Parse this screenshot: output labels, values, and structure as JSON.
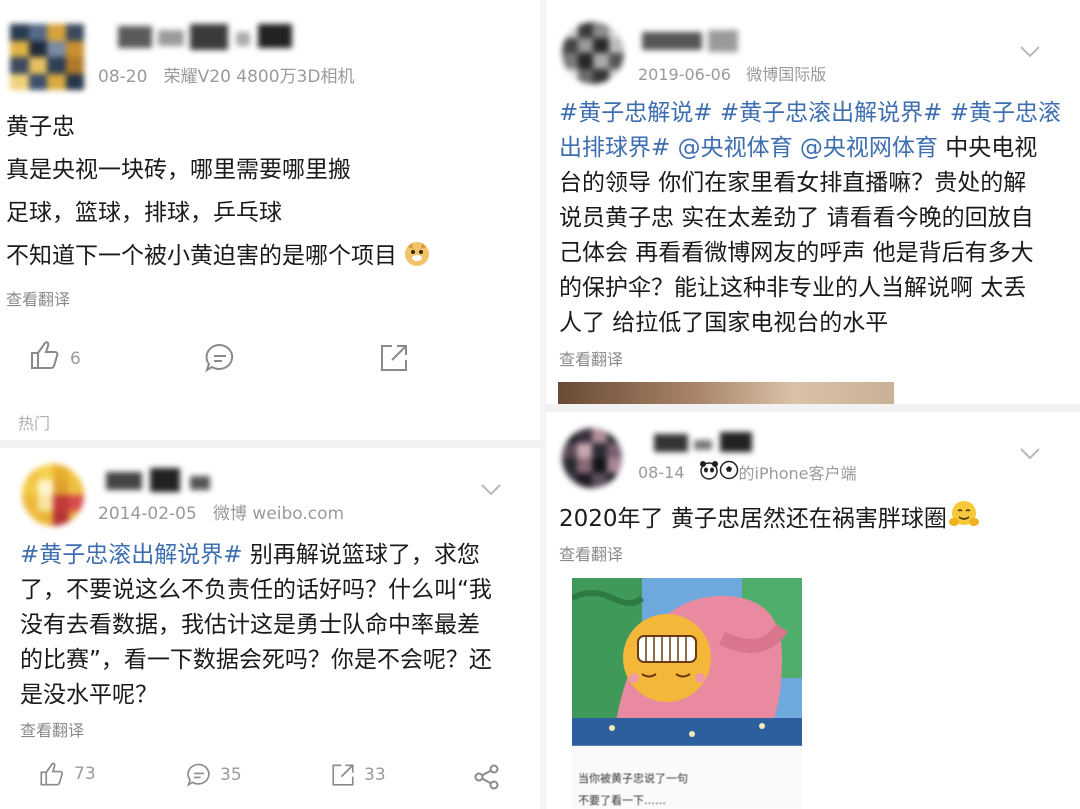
{
  "left_top": {
    "date": "08-20",
    "device": "荣耀V20 4800万3D相机",
    "lines": [
      "黄子忠",
      "真是央视一块砖，哪里需要哪里搬",
      "足球，篮球，排球，乒乓球",
      "不知道下一个被小黄迫害的是哪个项目"
    ],
    "translate": "查看翻译",
    "likes": "6",
    "section_label": "热门"
  },
  "left_bottom": {
    "date": "2014-02-05",
    "source": "微博 weibo.com",
    "tag": "#黄子忠滚出解说界#",
    "lines": [
      "别再解说篮球了，求您",
      "了，不要说这么不负责任的话好吗？什么叫“我",
      "没有去看数据，我估计这是勇士队命中率最差",
      "的比赛”，看一下数据会死吗？你是不会呢？还",
      "是没水平呢？"
    ],
    "translate": "查看翻译",
    "likes": "73",
    "comments": "35",
    "reposts": "33"
  },
  "right_top": {
    "date": "2019-06-06",
    "source": "微博国际版",
    "tag_line_1": "#黄子忠解说# #黄子忠滚出解说界# #黄子忠滚",
    "tag_line_2": "出排球界# @央视体育 @央视网体育",
    "text_tail_2": "中央电视",
    "lines": [
      "台的领导 你们在家里看女排直播嘛？贵处的解",
      "说员黄子忠 实在太差劲了 请看看今晚的回放自",
      "己体会 再看看微博网友的呼声 他是背后有多大",
      "的保护伞？能让这种非专业的人当解说啊 太丢",
      "人了 给拉低了国家电视台的水平"
    ],
    "translate": "查看翻译"
  },
  "right_bottom": {
    "date": "08-14",
    "source": "的iPhone客户端",
    "text": "2020年了 黄子忠居然还在祸害胖球圈",
    "translate": "查看翻译",
    "caption_1": "当你被黄子忠说了一句",
    "caption_2": "不要了看一下……"
  },
  "icons": [
    "thumbs-up-icon",
    "comment-icon",
    "repost-icon",
    "share-icon",
    "chevron-down-icon",
    "doge-emoji-icon",
    "hug-emoji-icon",
    "panda-icon",
    "soccer-icon"
  ],
  "colors": {
    "tag_blue": "#3d6fb0",
    "meta_gray": "#9a9a9a",
    "divider": "#ececec"
  }
}
